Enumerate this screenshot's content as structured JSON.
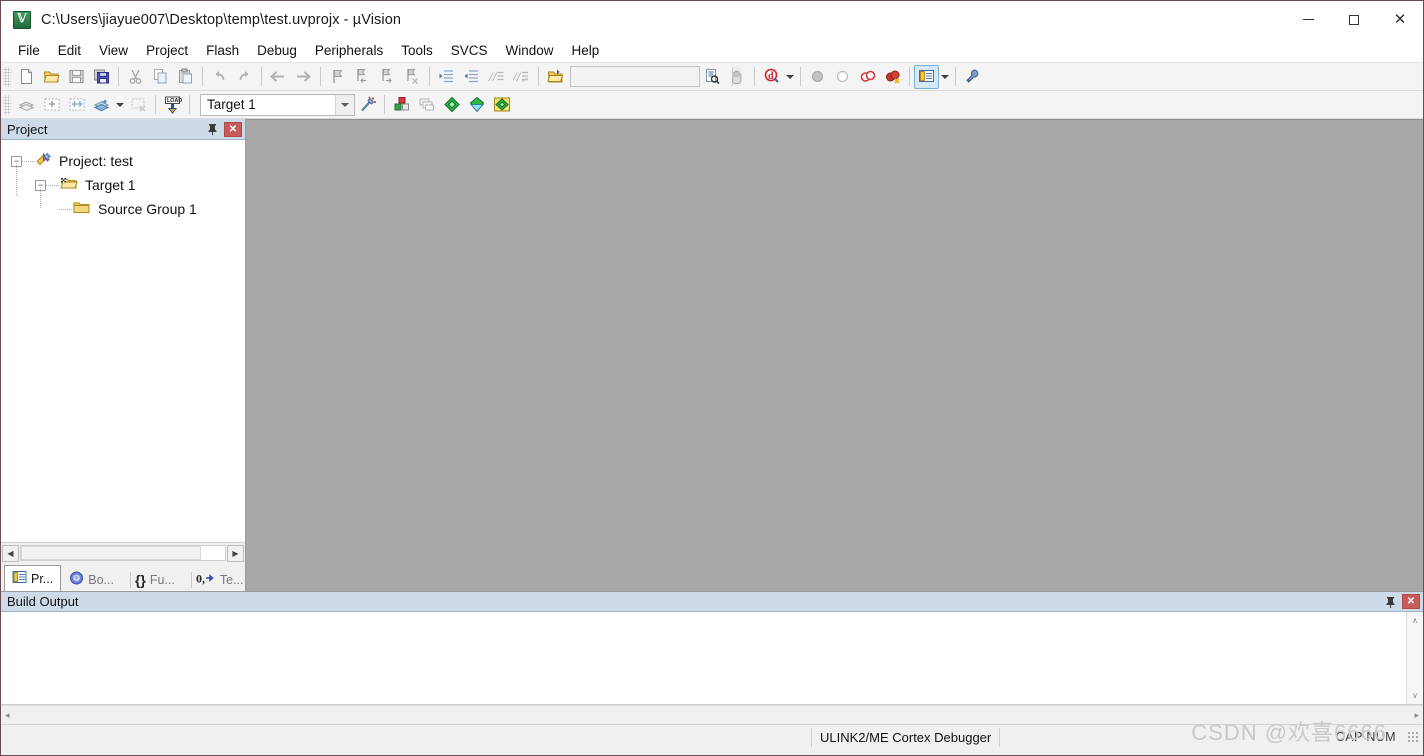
{
  "window": {
    "title": "C:\\Users\\jiayue007\\Desktop\\temp\\test.uvprojx - µVision",
    "app_icon": "uvision-logo-icon",
    "minimize": "–",
    "maximize": "□",
    "close": "✕"
  },
  "menu": {
    "items": [
      {
        "label": "File"
      },
      {
        "label": "Edit"
      },
      {
        "label": "View"
      },
      {
        "label": "Project"
      },
      {
        "label": "Flash"
      },
      {
        "label": "Debug"
      },
      {
        "label": "Peripherals"
      },
      {
        "label": "Tools"
      },
      {
        "label": "SVCS"
      },
      {
        "label": "Window"
      },
      {
        "label": "Help"
      }
    ]
  },
  "toolbar_file": {
    "buttons": [
      {
        "name": "new-file-icon",
        "title": "New"
      },
      {
        "name": "open-file-icon",
        "title": "Open"
      },
      {
        "name": "save-icon",
        "title": "Save"
      },
      {
        "name": "save-all-icon",
        "title": "Save All"
      },
      {
        "name": "cut-icon",
        "title": "Cut"
      },
      {
        "name": "copy-icon",
        "title": "Copy"
      },
      {
        "name": "paste-icon",
        "title": "Paste"
      },
      {
        "name": "undo-icon",
        "title": "Undo"
      },
      {
        "name": "redo-icon",
        "title": "Redo"
      },
      {
        "name": "navigate-back-icon",
        "title": "Back"
      },
      {
        "name": "navigate-forward-icon",
        "title": "Forward"
      },
      {
        "name": "bookmark-toggle-icon",
        "title": "Insert/Remove Bookmark"
      },
      {
        "name": "bookmark-prev-icon",
        "title": "Previous Bookmark"
      },
      {
        "name": "bookmark-next-icon",
        "title": "Next Bookmark"
      },
      {
        "name": "bookmark-clear-icon",
        "title": "Clear All Bookmarks"
      },
      {
        "name": "indent-icon",
        "title": "Indent Selection"
      },
      {
        "name": "outdent-icon",
        "title": "Outdent Selection"
      },
      {
        "name": "comment-icon",
        "title": "Comment Selection"
      },
      {
        "name": "uncomment-icon",
        "title": "Uncomment Selection"
      },
      {
        "name": "open-folder-icon",
        "title": "Open Project Folder"
      }
    ],
    "search": {
      "value": "",
      "placeholder": ""
    },
    "find_in_files": "find-in-files-icon",
    "bookmark-hand": "incremental-find-icon",
    "browse": "start-debug-icon",
    "breakpoints": [
      {
        "name": "insert-breakpoint-icon"
      },
      {
        "name": "disable-breakpoint-icon"
      },
      {
        "name": "disable-all-breakpoints-icon"
      },
      {
        "name": "kill-all-breakpoints-icon"
      }
    ],
    "window_manager": "window-manager-icon",
    "configuration": "configuration-wizard-icon"
  },
  "toolbar_build": {
    "buttons": [
      {
        "name": "translate-file-icon",
        "title": "Translate"
      },
      {
        "name": "build-target-icon",
        "title": "Build"
      },
      {
        "name": "rebuild-all-icon",
        "title": "Rebuild"
      },
      {
        "name": "batch-build-icon",
        "title": "Batch Build"
      },
      {
        "name": "stop-build-icon",
        "title": "Stop Build"
      },
      {
        "name": "download-icon",
        "title": "Download"
      }
    ],
    "target_select": {
      "value": "Target 1"
    },
    "target_options": "target-options-icon",
    "manage_items": [
      {
        "name": "manage-project-items-icon"
      },
      {
        "name": "manage-multi-project-icon"
      },
      {
        "name": "pack-installer-icon"
      },
      {
        "name": "manage-run-time-env-icon"
      },
      {
        "name": "select-software-packs-icon"
      }
    ]
  },
  "project_panel": {
    "title": "Project",
    "pin_icon": "pin-icon",
    "close_icon": "close-icon",
    "tree": [
      {
        "label": "Project: test",
        "icon": "project-icon",
        "expander": "−",
        "level": 0
      },
      {
        "label": "Target 1",
        "icon": "target-folder-icon",
        "expander": "−",
        "level": 1
      },
      {
        "label": "Source Group 1",
        "icon": "source-group-folder-icon",
        "expander": "",
        "level": 2
      }
    ],
    "tabs": [
      {
        "label": "Pr...",
        "icon": "project-tab-icon",
        "active": true
      },
      {
        "label": "Bo...",
        "icon": "books-tab-icon",
        "active": false
      },
      {
        "label": "Fu...",
        "icon": "functions-tab-icon",
        "active": false
      },
      {
        "label": "Te...",
        "icon": "templates-tab-icon",
        "active": false
      }
    ],
    "scroll_left": "◀",
    "scroll_right": "▶"
  },
  "build_output": {
    "title": "Build Output",
    "pin_icon": "pin-icon",
    "close_icon": "close-icon",
    "content": "",
    "scroll_up": "∧",
    "scroll_down": "∨",
    "scroll_left": "◂",
    "scroll_right": "▸"
  },
  "status_bar": {
    "debugger": "ULINK2/ME Cortex Debugger",
    "caps": "CAP NUM",
    "watermark": "CSDN @欢喜6666"
  },
  "colors": {
    "panel_header": "#cddbe8",
    "mdi_background": "#a8a8a8",
    "close_red": "#c75b5b",
    "toolbar_bg": "#f4f4f4"
  }
}
